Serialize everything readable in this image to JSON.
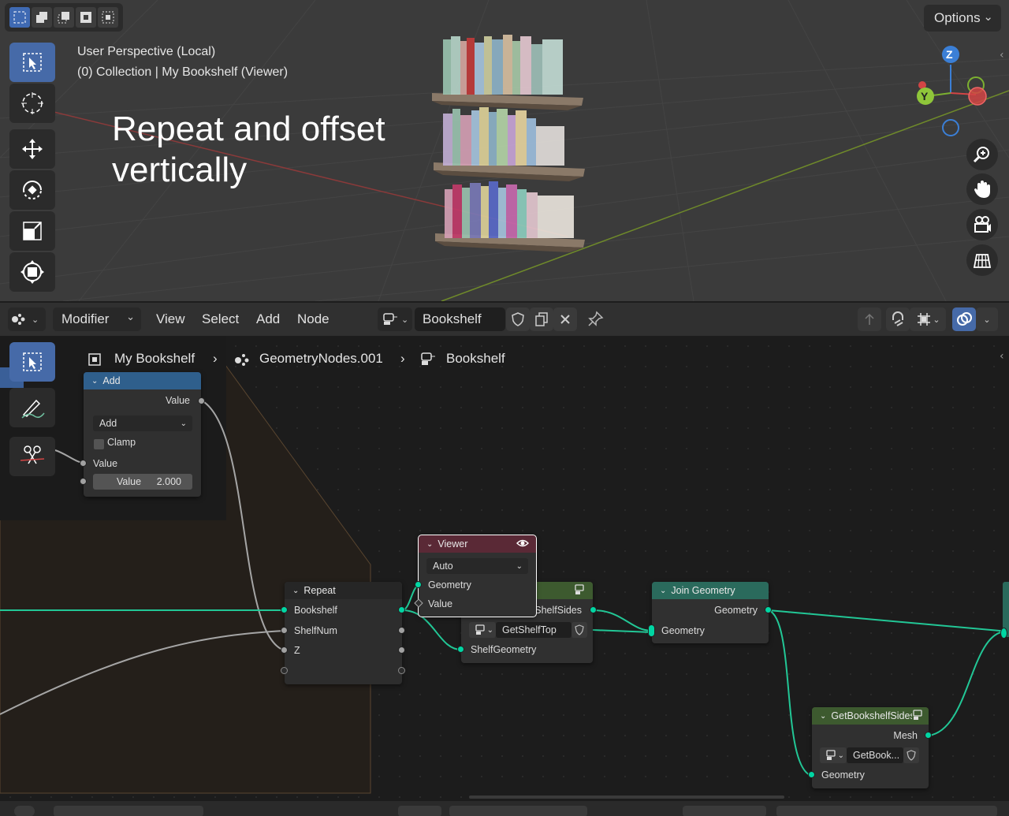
{
  "viewport": {
    "select_modes": [
      "select-new",
      "select-extend",
      "select-subtract",
      "select-invert",
      "select-intersect"
    ],
    "options_label": "Options",
    "perspective_label": "User Perspective (Local)",
    "collection_label": "(0) Collection | My Bookshelf (Viewer)",
    "caption_line1": "Repeat and offset",
    "caption_line2": "vertically",
    "gizmo": {
      "z": "Z",
      "y": "Y"
    },
    "tools": [
      "select-box-icon",
      "cursor-icon",
      "move-icon",
      "rotate-icon",
      "scale-icon",
      "transform-icon"
    ],
    "nav_buttons": [
      "zoom-icon",
      "pan-hand-icon",
      "camera-icon",
      "grid-view-icon"
    ]
  },
  "node_header": {
    "editor_type": "Modifier",
    "menus": [
      "View",
      "Select",
      "Add",
      "Node"
    ],
    "node_group_name": "Bookshelf"
  },
  "breadcrumb": {
    "object": "My Bookshelf",
    "modifier": "GeometryNodes.001",
    "group": "Bookshelf"
  },
  "nodes": {
    "add": {
      "title": "Add",
      "output": "Value",
      "operation": "Add",
      "clamp_label": "Clamp",
      "input_label": "Value",
      "value_label": "Value",
      "value": "2.000"
    },
    "viewer": {
      "title": "Viewer",
      "domain": "Auto",
      "geometry": "Geometry",
      "value": "Value"
    },
    "repeat": {
      "title": "Repeat",
      "inputs": [
        "Bookshelf",
        "ShelfNum",
        "Z"
      ]
    },
    "get_shelf": {
      "output": "ShelfSides",
      "group_name": "GetShelfTop",
      "input": "ShelfGeometry"
    },
    "join": {
      "title": "Join Geometry",
      "output": "Geometry",
      "input": "Geometry"
    },
    "get_sides": {
      "title": "GetBookshelfSides",
      "output": "Mesh",
      "group_name": "GetBook...",
      "input": "Geometry"
    }
  },
  "colors": {
    "accent_blue": "#466aa8",
    "geometry_socket": "#00d6a3",
    "geometry_header": "#2a6a5c",
    "math_header": "#2f5f8c",
    "group_header": "#3d5a2f",
    "viewer_header": "#5a2936",
    "frame": "#3a2c1f"
  }
}
